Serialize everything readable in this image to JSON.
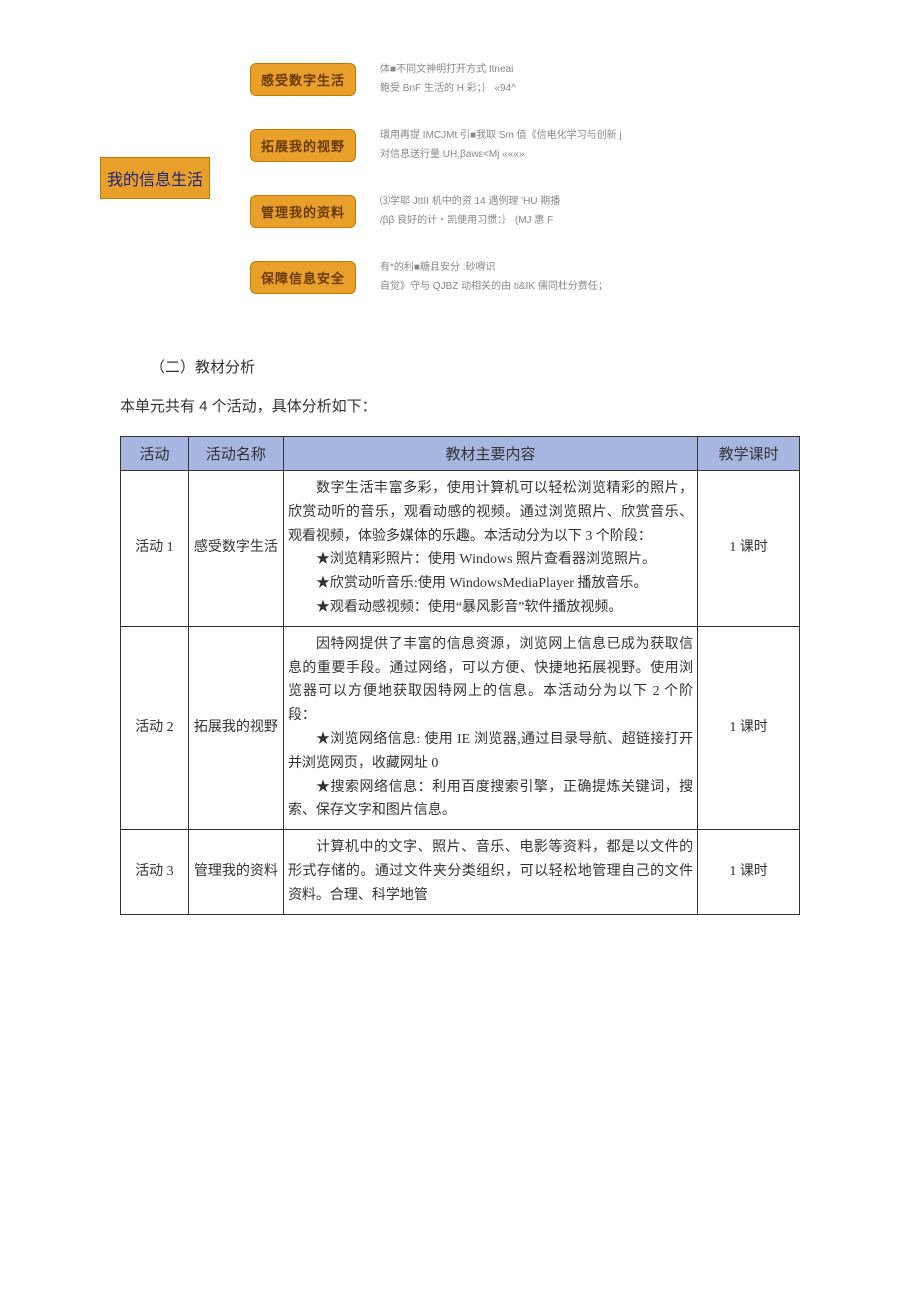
{
  "diagram": {
    "root": "我的信息生活",
    "branches": [
      {
        "label": "感受数字生活",
        "desc": [
          "体■不同文神明打开方式   Itneai",
          "鲍受 BnF 生活的 H 彩；｝ «94^"
        ]
      },
      {
        "label": "拓展我的视野",
        "desc": [
          "環用再提 IMCJMt 引■我取 Sm 值《信电化学习与创新 j",
          "对信息送行量 UH,βawε<Mj        «««»"
        ]
      },
      {
        "label": "管理我的资料",
        "desc": [
          "⑶学耶 JttII 机中的资 14 遇例理        'HU 期播",
          "/ββ 良好的计・凯便用习惯：｝  (MJ 惠 F"
        ]
      },
      {
        "label": "保障信息安全",
        "desc": [
          "有*的利■糖且安分        :砂嘚识",
          "自觉》守与 QJBZ 动相关的由 ti&IK 儒同杜分费任；"
        ]
      }
    ]
  },
  "section_heading": "（二）教材分析",
  "intro_line": "本单元共有 4 个活动，具体分析如下：",
  "table": {
    "headers": {
      "activity": "活动",
      "name": "活动名称",
      "content": "教材主要内容",
      "hours": "教学课时"
    },
    "rows": [
      {
        "activity": "活动 1",
        "name": "感受数字生活",
        "content_intro": "数字生活丰富多彩，使用计算机可以轻松浏览精彩的照片，欣赏动听的音乐，观看动感的视频。通过浏览照片、欣赏音乐、观看视频，体验多媒体的乐趣。本活动分为以下 3 个阶段：",
        "stars": [
          "★浏览精彩照片：使用 Windows 照片查看器浏览照片。",
          "★欣赏动听音乐:使用 WindowsMediaPlayer 播放音乐。",
          "★观看动感视频：使用“暴风影音”软件播放视频。"
        ],
        "hours": "1 课时"
      },
      {
        "activity": "活动 2",
        "name": "拓展我的视野",
        "content_intro": "因特网提供了丰富的信息资源，浏览网上信息已成为获取信息的重要手段。通过网络，可以方便、快捷地拓展视野。使用浏览器可以方便地获取因特网上的信息。本活动分为以下 2 个阶段：",
        "stars": [
          "★浏览网络信息: 使用 IE 浏览器,通过目录导航、超链接打开并浏览网页，收藏网址 0",
          "★搜索网络信息：利用百度搜索引擎，正确提炼关键词，搜索、保存文字和图片信息。"
        ],
        "hours": "1 课时"
      },
      {
        "activity": "活动 3",
        "name": "管理我的资料",
        "content_intro": "计算机中的文字、照片、音乐、电影等资料，都是以文件的形式存储的。通过文件夹分类组织，可以轻松地管理自己的文件资料。合理、科学地管",
        "stars": [],
        "hours": "1 课时"
      }
    ]
  }
}
